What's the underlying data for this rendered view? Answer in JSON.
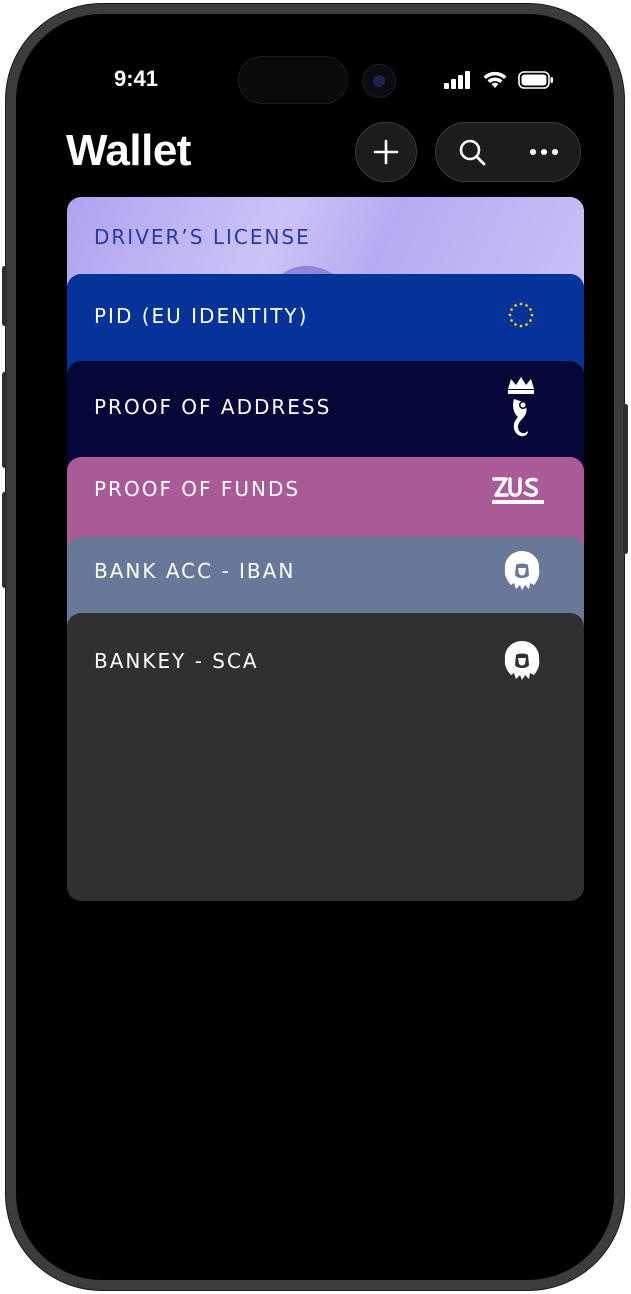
{
  "status_bar": {
    "time": "9:41"
  },
  "header": {
    "title": "Wallet"
  },
  "cards": [
    {
      "label": "DRIVER’S LICENSE",
      "color": "#b9aff0",
      "logo": "driver-license-emblem"
    },
    {
      "label": "PID (EU IDENTITY)",
      "color": "#05339a",
      "logo": "eu-stars-icon"
    },
    {
      "label": "PROOF OF ADDRESS",
      "color": "#040738",
      "logo": "warsaw-mermaid-crest-icon"
    },
    {
      "label": "PROOF OF FUNDS",
      "color": "#a95a97",
      "logo": "zus"
    },
    {
      "label": "BANK ACC - IBAN",
      "color": "#677899",
      "logo": "lion-head-icon"
    },
    {
      "label": "BANKEY - SCA",
      "color": "#313031",
      "logo": "lion-head-icon"
    }
  ],
  "colors": {
    "screen_bg": "#000000",
    "frame": "#3c3c3e",
    "button_bg": "#1c1c1e"
  }
}
